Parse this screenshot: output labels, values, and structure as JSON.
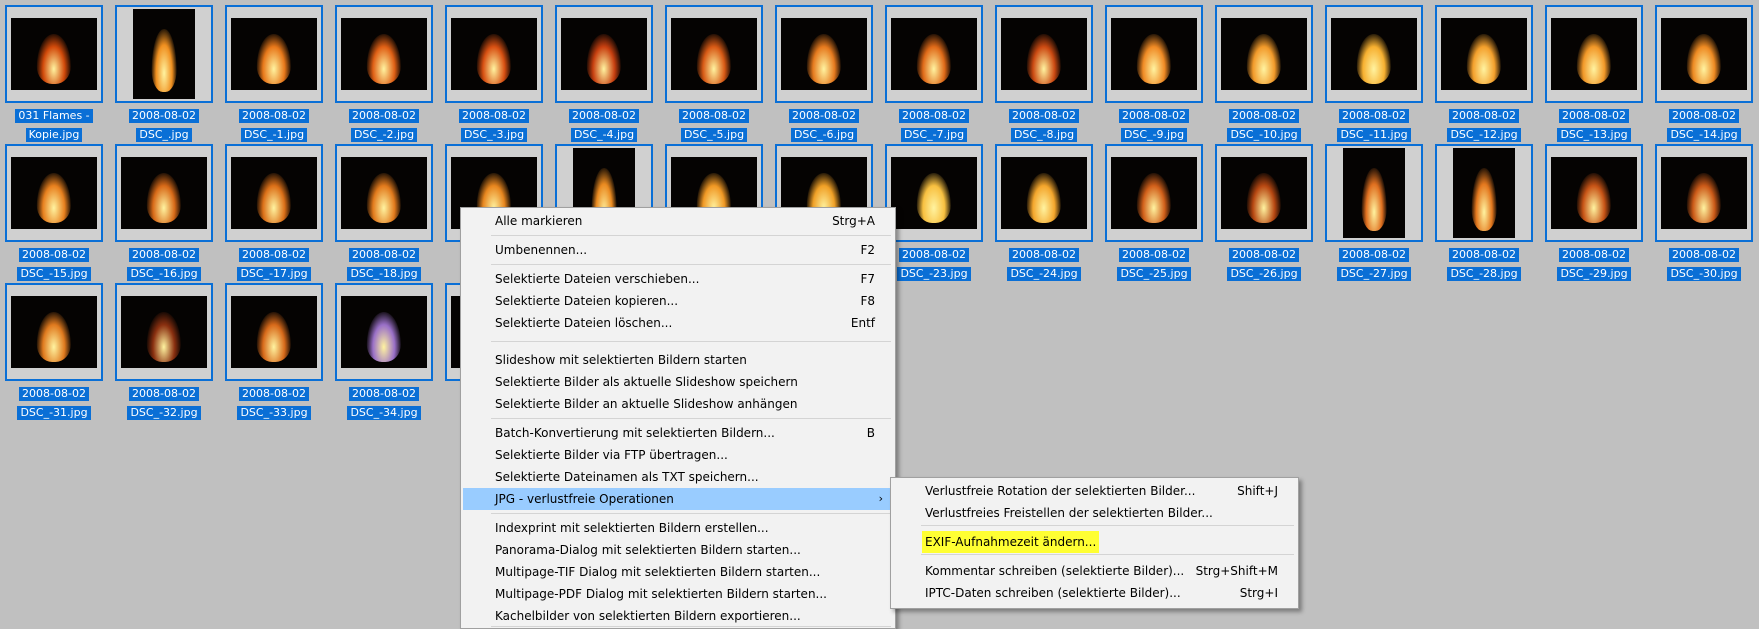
{
  "thumbnails": [
    {
      "line1": "031 Flames -",
      "line2": "Kopie.jpg",
      "hue": "#d24a0a",
      "portrait": false
    },
    {
      "line1": "2008-08-02",
      "line2": "DSC_.jpg",
      "hue": "#f09020",
      "portrait": true
    },
    {
      "line1": "2008-08-02",
      "line2": "DSC_-1.jpg",
      "hue": "#e8781a",
      "portrait": false
    },
    {
      "line1": "2008-08-02",
      "line2": "DSC_-2.jpg",
      "hue": "#e06015",
      "portrait": false
    },
    {
      "line1": "2008-08-02",
      "line2": "DSC_-3.jpg",
      "hue": "#d85012",
      "portrait": false
    },
    {
      "line1": "2008-08-02",
      "line2": "DSC_-4.jpg",
      "hue": "#c84010",
      "portrait": false
    },
    {
      "line1": "2008-08-02",
      "line2": "DSC_-5.jpg",
      "hue": "#d85a15",
      "portrait": false
    },
    {
      "line1": "2008-08-02",
      "line2": "DSC_-6.jpg",
      "hue": "#e67a1e",
      "portrait": false
    },
    {
      "line1": "2008-08-02",
      "line2": "DSC_-7.jpg",
      "hue": "#e06a18",
      "portrait": false
    },
    {
      "line1": "2008-08-02",
      "line2": "DSC_-8.jpg",
      "hue": "#cc4a12",
      "portrait": false
    },
    {
      "line1": "2008-08-02",
      "line2": "DSC_-9.jpg",
      "hue": "#f08a24",
      "portrait": false
    },
    {
      "line1": "2008-08-02",
      "line2": "DSC_-10.jpg",
      "hue": "#f29a2a",
      "portrait": false
    },
    {
      "line1": "2008-08-02",
      "line2": "DSC_-11.jpg",
      "hue": "#f7b030",
      "portrait": false
    },
    {
      "line1": "2008-08-02",
      "line2": "DSC_-12.jpg",
      "hue": "#f4a02c",
      "portrait": false
    },
    {
      "line1": "2008-08-02",
      "line2": "DSC_-13.jpg",
      "hue": "#f29828",
      "portrait": false
    },
    {
      "line1": "2008-08-02",
      "line2": "DSC_-14.jpg",
      "hue": "#ee8a22",
      "portrait": false
    },
    {
      "line1": "2008-08-02",
      "line2": "DSC_-15.jpg",
      "hue": "#e8801e",
      "portrait": false
    },
    {
      "line1": "2008-08-02",
      "line2": "DSC_-16.jpg",
      "hue": "#d86a18",
      "portrait": false
    },
    {
      "line1": "2008-08-02",
      "line2": "DSC_-17.jpg",
      "hue": "#dc7018",
      "portrait": false
    },
    {
      "line1": "2008-08-02",
      "line2": "DSC_-18.jpg",
      "hue": "#e27a1c",
      "portrait": false
    },
    {
      "line1": "",
      "line2": "",
      "hue": "#e8861e",
      "portrait": false
    },
    {
      "line1": "",
      "line2": "",
      "hue": "#ea8a20",
      "portrait": true
    },
    {
      "line1": "",
      "line2": "",
      "hue": "#f09824",
      "portrait": false
    },
    {
      "line1": "",
      "line2": "",
      "hue": "#f0a026",
      "portrait": false
    },
    {
      "line1": "2008-08-02",
      "line2": "DSC_-23.jpg",
      "hue": "#f8c040",
      "portrait": false
    },
    {
      "line1": "2008-08-02",
      "line2": "DSC_-24.jpg",
      "hue": "#f4a62c",
      "portrait": false
    },
    {
      "line1": "2008-08-02",
      "line2": "DSC_-25.jpg",
      "hue": "#d2601a",
      "portrait": false
    },
    {
      "line1": "2008-08-02",
      "line2": "DSC_-26.jpg",
      "hue": "#b84812",
      "portrait": false
    },
    {
      "line1": "2008-08-02",
      "line2": "DSC_-27.jpg",
      "hue": "#e07020",
      "portrait": true
    },
    {
      "line1": "2008-08-02",
      "line2": "DSC_-28.jpg",
      "hue": "#e4781e",
      "portrait": true
    },
    {
      "line1": "2008-08-02",
      "line2": "DSC_-29.jpg",
      "hue": "#c85416",
      "portrait": false
    },
    {
      "line1": "2008-08-02",
      "line2": "DSC_-30.jpg",
      "hue": "#cc5a18",
      "portrait": false
    },
    {
      "line1": "2008-08-02",
      "line2": "DSC_-31.jpg",
      "hue": "#e07a1e",
      "portrait": false
    },
    {
      "line1": "2008-08-02",
      "line2": "DSC_-32.jpg",
      "hue": "#8a3010",
      "portrait": false
    },
    {
      "line1": "2008-08-02",
      "line2": "DSC_-33.jpg",
      "hue": "#d86a1a",
      "portrait": false
    },
    {
      "line1": "2008-08-02",
      "line2": "DSC_-34.jpg",
      "hue": "#9a70c8",
      "portrait": false
    },
    {
      "line1": "",
      "line2": "",
      "hue": "#c85014",
      "portrait": false
    }
  ],
  "context_menu": {
    "items": [
      {
        "label": "Alle markieren",
        "shortcut": "Strg+A"
      },
      {
        "label": "Umbenennen...",
        "shortcut": "F2"
      },
      {
        "label": "Selektierte Dateien verschieben...",
        "shortcut": "F7"
      },
      {
        "label": "Selektierte Dateien kopieren...",
        "shortcut": "F8"
      },
      {
        "label": "Selektierte Dateien löschen...",
        "shortcut": "Entf"
      },
      {
        "label": "Slideshow mit selektierten Bildern starten",
        "shortcut": ""
      },
      {
        "label": "Selektierte Bilder als aktuelle Slideshow speichern",
        "shortcut": ""
      },
      {
        "label": "Selektierte Bilder an aktuelle Slideshow anhängen",
        "shortcut": ""
      },
      {
        "label": "Batch-Konvertierung mit selektierten Bildern...",
        "shortcut": "B"
      },
      {
        "label": "Selektierte Bilder via FTP übertragen...",
        "shortcut": ""
      },
      {
        "label": "Selektierte Dateinamen als TXT speichern...",
        "shortcut": ""
      },
      {
        "label": "JPG - verlustfreie Operationen",
        "shortcut": ""
      },
      {
        "label": "Indexprint mit selektierten Bildern erstellen...",
        "shortcut": ""
      },
      {
        "label": "Panorama-Dialog mit selektierten Bildern starten...",
        "shortcut": ""
      },
      {
        "label": "Multipage-TIF Dialog mit selektierten Bildern starten...",
        "shortcut": ""
      },
      {
        "label": "Multipage-PDF Dialog mit selektierten Bildern starten...",
        "shortcut": ""
      },
      {
        "label": "Kachelbilder von selektierten Bildern exportieren...",
        "shortcut": ""
      }
    ]
  },
  "submenu": {
    "items": [
      {
        "label": "Verlustfreie Rotation der selektierten Bilder...",
        "shortcut": "Shift+J"
      },
      {
        "label": "Verlustfreies Freistellen der selektierten Bilder...",
        "shortcut": ""
      },
      {
        "label": "EXIF-Aufnahmezeit ändern...",
        "shortcut": ""
      },
      {
        "label": "Kommentar schreiben (selektierte Bilder)...",
        "shortcut": "Strg+Shift+M"
      },
      {
        "label": "IPTC-Daten schreiben (selektierte Bilder)...",
        "shortcut": "Strg+I"
      }
    ]
  },
  "icons": {
    "submenu_arrow": "chevron-right-icon"
  },
  "colors": {
    "selection": "#0a6fd6",
    "menu_highlight": "#99ccff",
    "text_highlight": "#ffff33",
    "background": "#c0c0c0"
  }
}
